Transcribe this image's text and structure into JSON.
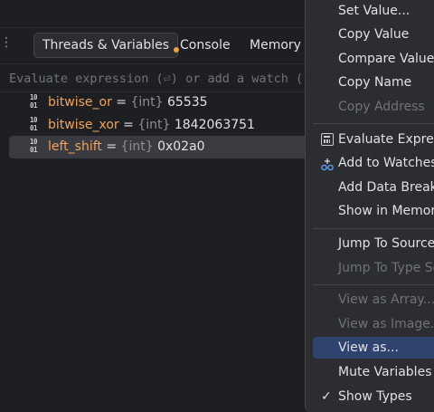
{
  "debugger": {
    "tabs": {
      "threads_label": "Threads & Variables",
      "console_label": "Console",
      "memory_label": "Memory V"
    },
    "evaluate": {
      "placeholder": "Evaluate expression (⏎) or add a watch (⇧"
    },
    "variables": [
      {
        "name": "bitwise_or",
        "eq": " = ",
        "type": "{int}",
        "value": " 65535",
        "icon": "10\n01"
      },
      {
        "name": "bitwise_xor",
        "eq": " = ",
        "type": "{int}",
        "value": " 1842063751",
        "icon": "10\n01"
      },
      {
        "name": "left_shift",
        "eq": " = ",
        "type": "{int}",
        "value": " 0x02a0",
        "icon": "10\n01"
      }
    ]
  },
  "context_menu": {
    "items": [
      {
        "label": "Set Value...",
        "enabled": true
      },
      {
        "label": "Copy Value",
        "enabled": true
      },
      {
        "label": "Compare Value w",
        "enabled": true
      },
      {
        "label": "Copy Name",
        "enabled": true
      },
      {
        "label": "Copy Address",
        "enabled": false
      },
      {
        "label": "Evaluate Express",
        "enabled": true,
        "icon": "calculator-icon"
      },
      {
        "label": "Add to Watches",
        "enabled": true,
        "icon": "glasses-icon"
      },
      {
        "label": "Add Data Breakp",
        "enabled": true
      },
      {
        "label": "Show in Memory",
        "enabled": true
      },
      {
        "label": "Jump To Source",
        "enabled": true
      },
      {
        "label": "Jump To Type So",
        "enabled": false
      },
      {
        "label": "View as Array...",
        "enabled": false
      },
      {
        "label": "View as Image...",
        "enabled": false
      },
      {
        "label": "View as...",
        "enabled": true,
        "highlighted": true
      },
      {
        "label": "Mute Variables",
        "enabled": true
      },
      {
        "label": "Show Types",
        "enabled": true,
        "checked": true,
        "check_glyph": "✓"
      }
    ]
  },
  "colors": {
    "background": "#1e1f22",
    "variable_name": "#f0a35c",
    "menu_background": "#2b2d30",
    "menu_highlight": "#2e436e",
    "disabled_text": "#6f737a"
  }
}
